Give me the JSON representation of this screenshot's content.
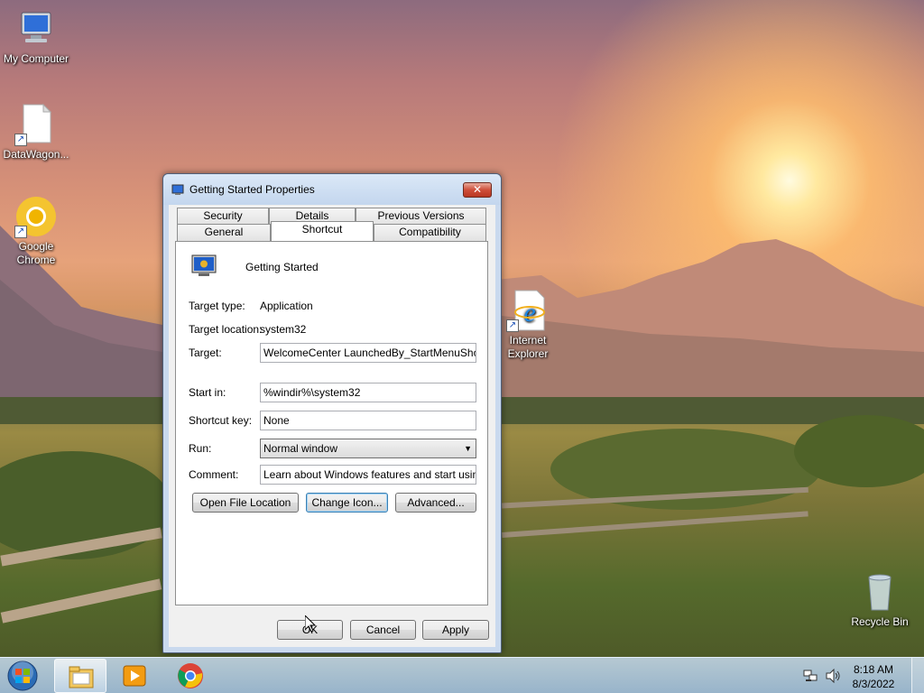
{
  "desktop": {
    "icons": [
      {
        "label": "My Computer",
        "icon": "computer-icon"
      },
      {
        "label": "DataWagon...",
        "icon": "document-icon"
      },
      {
        "label": "Google Chrome",
        "icon": "chrome-icon"
      },
      {
        "label": "Internet Explorer",
        "icon": "internet-explorer-icon"
      },
      {
        "label": "Recycle Bin",
        "icon": "recycle-bin-icon"
      }
    ]
  },
  "dialog": {
    "title": "Getting Started Properties",
    "close_label": "✕",
    "tabs_row1": [
      "Security",
      "Details",
      "Previous Versions"
    ],
    "tabs_row2": [
      "General",
      "Shortcut",
      "Compatibility"
    ],
    "active_tab": "Shortcut",
    "item_name": "Getting Started",
    "target_type_label": "Target type:",
    "target_type_value": "Application",
    "target_location_label": "Target location:",
    "target_location_value": "system32",
    "target_label": "Target:",
    "target_value": "WelcomeCenter LaunchedBy_StartMenuShortcut",
    "start_in_label": "Start in:",
    "start_in_value": "%windir%\\system32",
    "shortcut_key_label": "Shortcut key:",
    "shortcut_key_value": "None",
    "run_label": "Run:",
    "run_value": "Normal window",
    "comment_label": "Comment:",
    "comment_value": "Learn about Windows features and start using them",
    "open_file_location": "Open File Location",
    "change_icon": "Change Icon...",
    "advanced": "Advanced...",
    "ok": "OK",
    "cancel": "Cancel",
    "apply": "Apply"
  },
  "taskbar": {
    "time": "8:18 AM",
    "date": "8/3/2022",
    "pinned": [
      "windows-explorer-icon",
      "media-player-icon",
      "chrome-icon"
    ]
  },
  "colors": {
    "titlebar": "#c3d6ee",
    "close_button": "#cf4f3a",
    "dialog_bg": "#f0f0f0"
  }
}
